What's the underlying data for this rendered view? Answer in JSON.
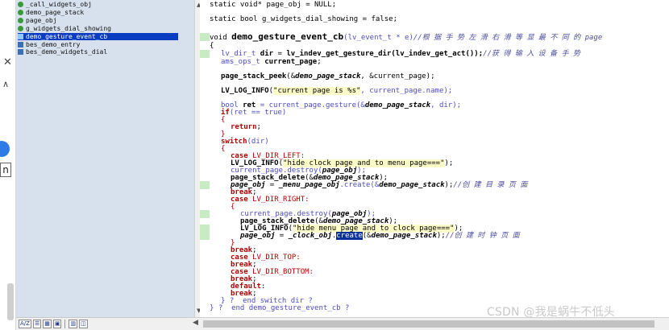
{
  "symbol_tree": {
    "items": [
      {
        "label": "_call_widgets_obj",
        "icon": "green",
        "selected": false
      },
      {
        "label": "demo_page_stack",
        "icon": "green",
        "selected": false
      },
      {
        "label": "page_obj",
        "icon": "green",
        "selected": false
      },
      {
        "label": "g_widgets_dial_showing",
        "icon": "green",
        "selected": false
      },
      {
        "label": "demo_gesture_event_cb",
        "icon": "blue",
        "selected": true
      },
      {
        "label": "bes_demo_entry",
        "icon": "blue",
        "selected": false
      },
      {
        "label": "bes_demo_widgets_dial",
        "icon": "blue",
        "selected": false
      }
    ],
    "bottom_buttons": [
      "A/Z",
      "☰",
      "▦",
      "▣",
      "▥",
      "◫"
    ]
  },
  "left_strip": {
    "close": "✕",
    "caret": "∧",
    "letter": "n"
  },
  "editor": {
    "watermark": "CSDN @我是蜗牛不低头",
    "lines": {
      "l01": "static void* page_obj = NULL;",
      "l02": "static bool g_widgets_dial_showing = false;",
      "l03a": "void ",
      "l03b": "demo_gesture_event_cb",
      "l03c": "(lv_event_t * e)",
      "l03d": "//根 据 手 势 左 滑 右 滑 等 显 最 不 同 的 page",
      "l04": "{",
      "l05a": "lv_dir_t ",
      "l05b": "dir",
      "l05c": " = ",
      "l05d": "lv_indev_get_gesture_dir(lv_indev_get_act());",
      "l05e": "//获 得 输 入 设 备 手 势",
      "l06a": "ams_ops_t ",
      "l06b": "current_page",
      "l06c": ";",
      "l07a": "page_stack_peek",
      "l07b": "(&",
      "l07c": "demo_page_stack",
      "l07d": ", &current_page);",
      "l08a": "LV_LOG_INFO",
      "l08b": "(",
      "l08c": "\"current page is %s\"",
      "l08d": ", current_page.name);",
      "l09a": "bool ",
      "l09b": "ret",
      "l09c": " = current_page.gesture(&",
      "l09d": "demo_page_stack",
      "l09e": ", dir);",
      "l10a": "if",
      "l10b": "(ret == true)",
      "l11": "{",
      "l12a": "return",
      "l12b": ";",
      "l13": "}",
      "l14a": "switch",
      "l14b": "(dir)",
      "l15": "{",
      "l16a": "case",
      "l16b": " LV_DIR_LEFT:",
      "l17a": "LV_LOG_INFO",
      "l17b": "(",
      "l17c": "\"hide clock page and to menu page===\"",
      "l17d": ");",
      "l18a": "current_page.destroy(",
      "l18b": "page_obj",
      "l18c": ");",
      "l19a": "page_stack_delete",
      "l19b": "(&",
      "l19c": "demo_page_stack",
      "l19d": ");",
      "l20a": "page_obj",
      "l20b": " = ",
      "l20c": "_menu_page_obj",
      "l20d": ".create(&",
      "l20e": "demo_page_stack",
      "l20f": ");",
      "l20g": "//创 建 目 录 页 面",
      "l21a": "break",
      "l21b": ";",
      "l22a": "case",
      "l22b": " LV_DIR_RIGHT:",
      "l23": "{",
      "l24a": "current_page.destroy(",
      "l24b": "page_obj",
      "l24c": ");",
      "l25a": "page_stack_delete",
      "l25b": "(&",
      "l25c": "demo_page_stack",
      "l25d": ");",
      "l26a": "LV_LOG_INFO",
      "l26b": "(",
      "l26c": "\"hide menu page and to clock page===\"",
      "l26d": ");",
      "l27a": "page_obj",
      "l27b": " = ",
      "l27c": "_clock_obj",
      "l27d": ".",
      "l27e": "create",
      "l27f": "(&",
      "l27g": "demo_page_stack",
      "l27h": ");",
      "l27i": "//创 建 时 钟 页 面",
      "l28": "}",
      "l29a": "break",
      "l29b": ";",
      "l30a": "case",
      "l30b": " LV_DIR_TOP:",
      "l31a": "break",
      "l31b": ";",
      "l32a": "case",
      "l32b": " LV_DIR_BOTTOM:",
      "l33a": "break",
      "l33b": ";",
      "l34a": "default",
      "l34b": ":",
      "l35a": "break",
      "l35b": ";",
      "l36": "} ?  end switch dir ?",
      "l37": "} ?  end demo_gesture_event_cb ?"
    }
  }
}
